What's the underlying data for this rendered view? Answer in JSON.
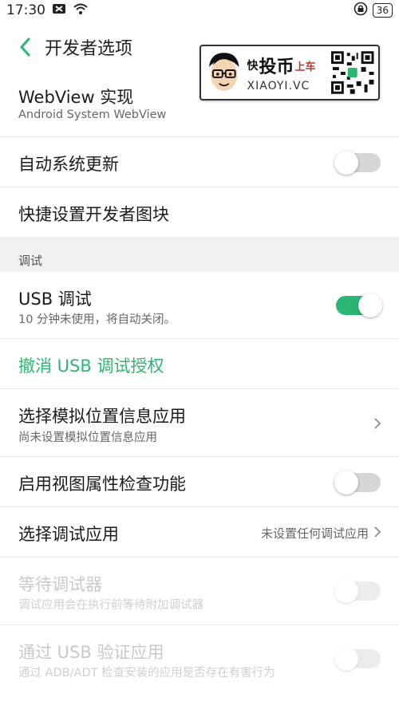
{
  "status_bar": {
    "time": "17:30",
    "battery": "36"
  },
  "header": {
    "title": "开发者选项"
  },
  "watermark": {
    "line1_a": "快",
    "line1_b": "投币",
    "line1_c": "上车",
    "line2": "XIAOYI.VC"
  },
  "items": {
    "webview": {
      "title": "WebView 实现",
      "subtitle": "Android System WebView"
    },
    "auto_update": {
      "title": "自动系统更新",
      "enabled": false
    },
    "quick_tiles": {
      "title": "快捷设置开发者图块"
    },
    "usb_debug": {
      "title": "USB 调试",
      "subtitle": "10 分钟未使用，将自动关闭。",
      "enabled": true
    },
    "revoke_usb": {
      "title": "撤消 USB 调试授权"
    },
    "mock_location": {
      "title": "选择模拟位置信息应用",
      "subtitle": "尚未设置模拟位置信息应用"
    },
    "view_attr": {
      "title": "启用视图属性检查功能",
      "enabled": false
    },
    "debug_app": {
      "title": "选择调试应用",
      "value": "未设置任何调试应用"
    },
    "wait_debugger": {
      "title": "等待调试器",
      "subtitle": "调试应用会在执行前等待附加调试器",
      "enabled": false,
      "disabled": true
    },
    "verify_usb": {
      "title": "通过 USB 验证应用",
      "subtitle": "通过 ADB/ADT 检查安装的应用是否存在有害行为",
      "enabled": false,
      "disabled": true
    }
  },
  "section": {
    "debug_label": "调试"
  },
  "colors": {
    "accent": "#2bb673",
    "section_bg": "#f0f0f0"
  }
}
